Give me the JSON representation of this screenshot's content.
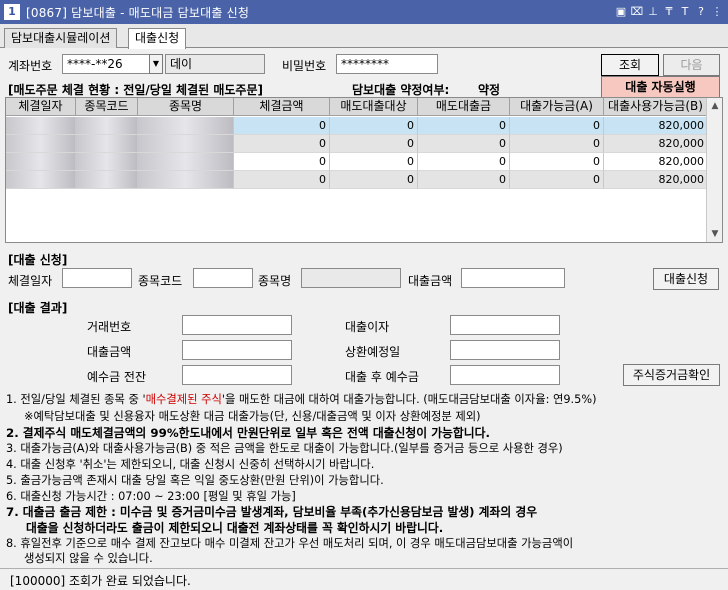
{
  "window": {
    "icon_text": "1",
    "title": "[0867] 담보대출 - 매도대금 담보대출 신청",
    "buttons": [
      "▣",
      "⌧",
      "⊥",
      "₸",
      "T",
      "?",
      "⋮"
    ]
  },
  "tabs": [
    {
      "label": "담보대출시뮬레이션"
    },
    {
      "label": "대출신청"
    }
  ],
  "account": {
    "label": "계좌번호",
    "number": "****-**26",
    "name": "데이",
    "pw_label": "비밀번호",
    "pw_value": "********",
    "inquiry_button": "조회",
    "next_button": "다음",
    "auto_button": "대출 자동실행"
  },
  "status_header": {
    "title": "[매도주문 체결 현황 : 전일/당일 체결된 매도주문]",
    "agreement_label": "담보대출 약정여부:",
    "agreement_value": "약정"
  },
  "grid": {
    "columns": [
      "체결일자",
      "종목코드",
      "종목명",
      "체결금액",
      "매도대출대상",
      "매도대출금",
      "대출가능금(A)",
      "대출사용가능금(B)"
    ],
    "rows": [
      [
        "",
        "",
        "",
        "0",
        "0",
        "0",
        "0",
        "820,000"
      ],
      [
        "",
        "",
        "",
        "0",
        "0",
        "0",
        "0",
        "820,000"
      ],
      [
        "",
        "",
        "",
        "0",
        "0",
        "0",
        "0",
        "820,000"
      ],
      [
        "",
        "",
        "",
        "0",
        "0",
        "0",
        "0",
        "820,000"
      ]
    ]
  },
  "loan_request": {
    "title": "[대출 신청]",
    "date_label": "체결일자",
    "code_label": "종목코드",
    "name_label": "종목명",
    "amount_label": "대출금액",
    "submit_button": "대출신청"
  },
  "loan_result": {
    "title": "[대출 결과]",
    "trade_no_label": "거래번호",
    "interest_label": "대출이자",
    "amount_label": "대출금액",
    "repay_date_label": "상환예정일",
    "deposit_before_label": "예수금 전잔",
    "deposit_after_label": "대출 후 예수금",
    "margin_button": "주식증거금확인"
  },
  "notes": [
    {
      "parts": [
        "1. 전일/당일 체결된 종목 중 '",
        "매수결제된 주식",
        "'을 매도한 대금에 대하여 대출가능합니다. (매도대금담보대출 이자율: 연9.5%)"
      ]
    },
    {
      "text": "※예탁담보대출 및 신용융자 매도상환 대금 대출가능(단, 신용/대출금액 및 이자 상환예정분 제외)"
    },
    {
      "text": "2. 결제주식 매도체결금액의 99%한도내에서 만원단위로 일부 혹은 전액 대출신청이 가능합니다."
    },
    {
      "text": "3. 대출가능금(A)와 대출사용가능금(B) 중 적은 금액을 한도로 대출이 가능합니다.(일부를 증거금 등으로 사용한 경우)"
    },
    {
      "text": "4. 대출 신청후 '취소'는 제한되오니, 대출 신청시 신중히 선택하시기 바랍니다."
    },
    {
      "text": "5. 출금가능금액 존재시 대출 당일 혹은 익일 중도상환(만원 단위)이 가능합니다."
    },
    {
      "text": "6. 대출신청 가능시간 : 07:00 ~ 23:00 [평일 및 휴일 가능]"
    },
    {
      "text": "7. 대출금 출금 제한 : 미수금 및 증거금미수금 발생계좌, 담보비율 부족(추가신용담보금 발생) 계좌의 경우"
    },
    {
      "text": "   대출을 신청하더라도 출금이 제한되오니 대출전 계좌상태를 꼭 확인하시기 바랍니다."
    },
    {
      "text": "8. 휴일전후 기준으로 매수 결제 잔고보다 매수 미결제 잔고가 우선 매도처리 되며, 이 경우 매도대금담보대출 가능금액이"
    },
    {
      "text": "   생성되지 않을 수 있습니다."
    }
  ],
  "statusbar": {
    "message": "[100000] 조회가 완료 되었습니다."
  }
}
